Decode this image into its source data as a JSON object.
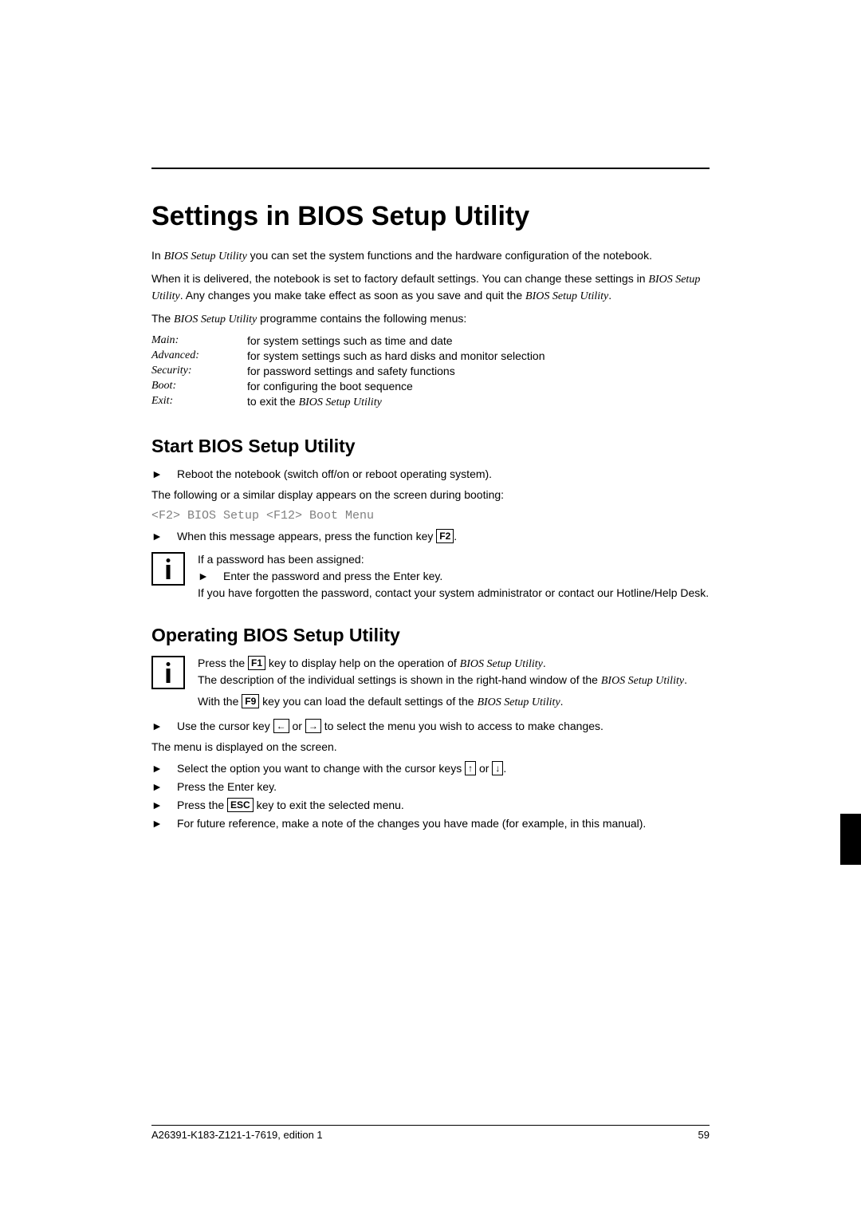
{
  "title": "Settings in BIOS Setup Utility",
  "intro": {
    "p1_a": "In ",
    "p1_ital": "BIOS Setup Utility",
    "p1_b": " you can set the system functions and the hardware configuration of the notebook.",
    "p2_a": "When it is delivered, the notebook is set to factory default settings. You can change these settings in ",
    "p2_ital1": "BIOS Setup Utility",
    "p2_b": ". Any changes you make take effect as soon as you save and quit the ",
    "p2_ital2": "BIOS Setup Utility",
    "p2_c": ".",
    "p3_a": "The ",
    "p3_ital": "BIOS Setup Utility",
    "p3_b": " programme contains the following menus:"
  },
  "menus": [
    {
      "label": "Main",
      "desc": "for system settings such as time and date"
    },
    {
      "label": "Advanced",
      "desc": "for system settings such as hard disks and monitor selection"
    },
    {
      "label": "Security",
      "desc": "for password settings and safety functions"
    },
    {
      "label": "Boot",
      "desc": "for configuring the boot sequence"
    },
    {
      "label": "Exit",
      "desc_a": "to exit the ",
      "desc_ital": "BIOS Setup Utility"
    }
  ],
  "start": {
    "heading": "Start BIOS Setup Utility",
    "step1": "Reboot the notebook (switch off/on or reboot operating system).",
    "p_following": "The following or a similar display appears on the screen during booting:",
    "code": "<F2> BIOS Setup   <F12> Boot Menu",
    "step2_a": "When this message appears, press the function key ",
    "step2_key": "F2",
    "step2_b": ".",
    "info": {
      "line1": "If a password has been assigned:",
      "step": "Enter the password and press the Enter key.",
      "line2": "If you have forgotten the password, contact your system administrator or contact our Hotline/Help Desk."
    }
  },
  "operating": {
    "heading": "Operating BIOS Setup Utility",
    "info": {
      "l1_a": "Press the ",
      "l1_key": "F1",
      "l1_b": " key to display help on the operation of ",
      "l1_ital": "BIOS Setup Utility",
      "l1_c": ".",
      "l2_a": "The description of the individual settings is shown in the right-hand window of the ",
      "l2_ital": "BIOS Setup Utility",
      "l2_b": ".",
      "l3_a": "With the ",
      "l3_key": "F9",
      "l3_b": " key you can load the default settings of the ",
      "l3_ital": "BIOS Setup Utility",
      "l3_c": "."
    },
    "step_cursor_a": "Use the cursor key ",
    "key_left": "←",
    "step_cursor_b": " or ",
    "key_right": "→",
    "step_cursor_c": " to select the menu you wish to access to make changes.",
    "p_menu_displayed": "The menu is displayed on the screen.",
    "step_select_a": "Select the option you want to change with the cursor keys ",
    "key_up": "↑",
    "step_select_b": " or ",
    "key_down": "↓",
    "step_select_c": ".",
    "step_enter": "Press the Enter key.",
    "step_esc_a": "Press the ",
    "step_esc_key": "ESC",
    "step_esc_b": " key to exit the selected menu.",
    "step_future": "For future reference, make a note of the changes you have made (for example, in this manual)."
  },
  "footer": {
    "left": "A26391-K183-Z121-1-7619, edition 1",
    "right": "59"
  }
}
